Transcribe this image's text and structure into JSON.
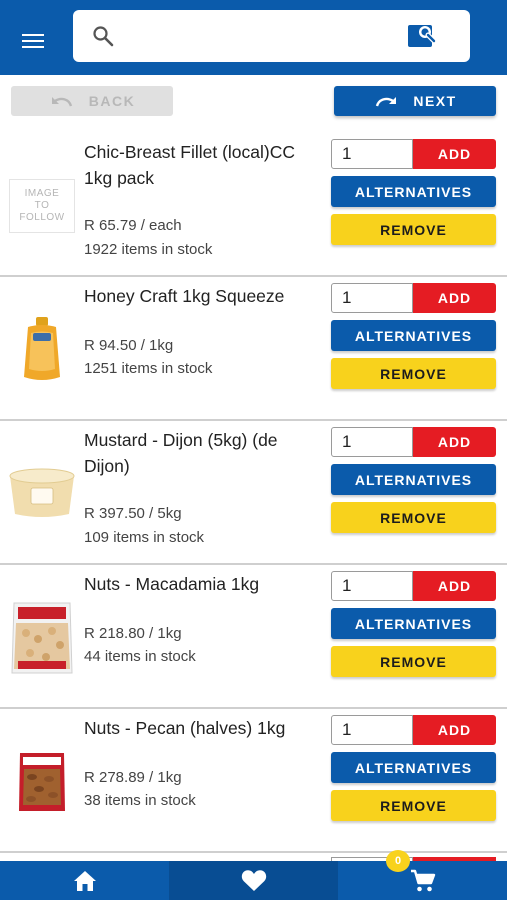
{
  "search": {
    "placeholder": "",
    "value": ""
  },
  "nav": {
    "back_label": "BACK",
    "next_label": "NEXT"
  },
  "colors": {
    "primary": "#0b5bab",
    "add": "#e51c23",
    "remove": "#f8d21c",
    "disabled": "#e0e0e0"
  },
  "buttons": {
    "add": "ADD",
    "alternatives": "ALTERNATIVES",
    "remove": "REMOVE"
  },
  "products": [
    {
      "name": "Chic-Breast Fillet (local)CC 1kg pack",
      "price": "R 65.79 / each",
      "stock": "1922 items in stock",
      "qty": "1",
      "image": "image-to-follow-placeholder",
      "placeholder_text": [
        "IMAGE",
        "TO",
        "FOLLOW"
      ]
    },
    {
      "name": "Honey Craft 1kg Squeeze",
      "price": "R 94.50 / 1kg",
      "stock": "1251 items in stock",
      "qty": "1",
      "image": "honey-bottle"
    },
    {
      "name": "Mustard - Dijon (5kg) (de Dijon)",
      "price": "R 397.50 / 5kg",
      "stock": "109 items in stock",
      "qty": "1",
      "image": "mustard-tub"
    },
    {
      "name": "Nuts - Macadamia 1kg",
      "price": "R 218.80 / 1kg",
      "stock": "44 items in stock",
      "qty": "1",
      "image": "macadamia-bag"
    },
    {
      "name": "Nuts - Pecan (halves) 1kg",
      "price": "R 278.89 / 1kg",
      "stock": "38 items in stock",
      "qty": "1",
      "image": "pecan-bag"
    }
  ],
  "bottom_nav": {
    "cart_count": "0",
    "tabs": [
      "home-icon",
      "heart-icon",
      "cart-icon"
    ]
  }
}
